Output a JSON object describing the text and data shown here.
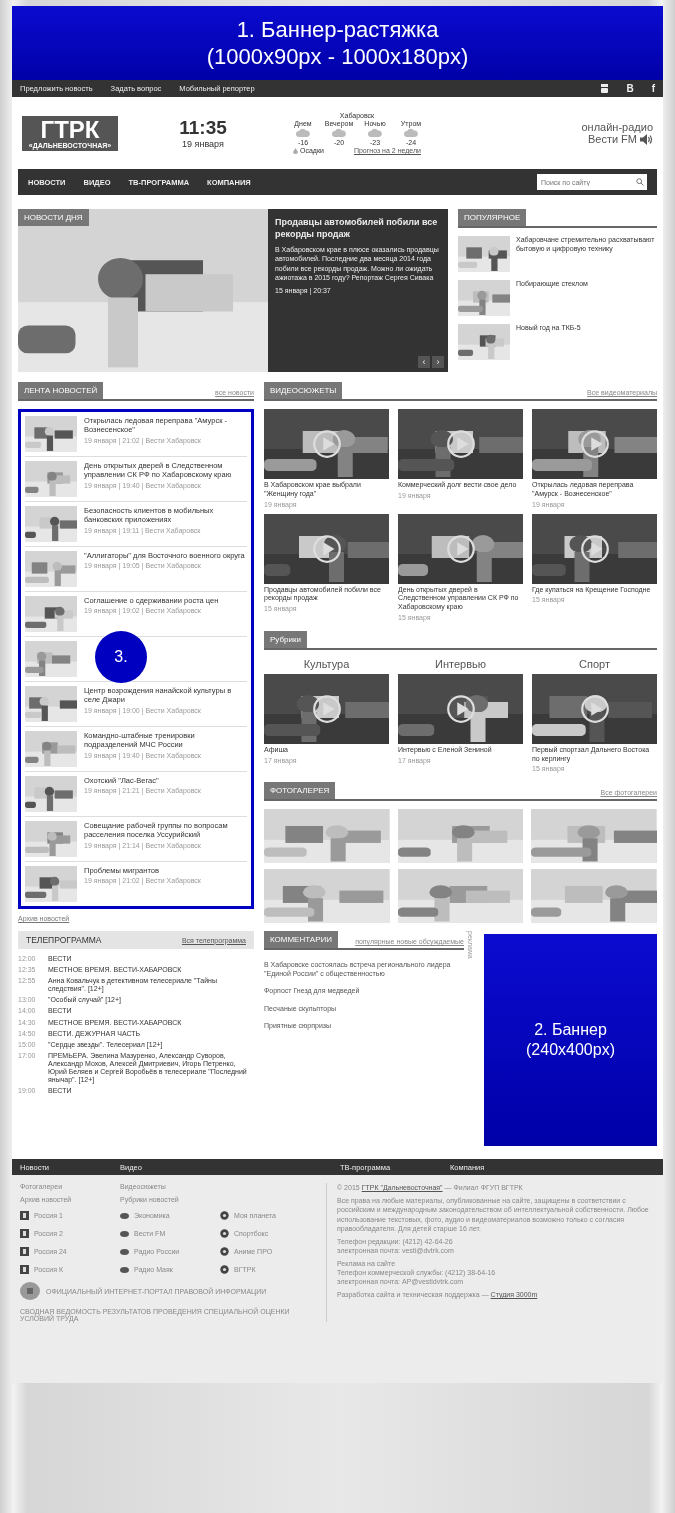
{
  "top_banner": {
    "line_1": "1. Баннер-растяжка",
    "line_2": "(1000x90px - 1000x180px)"
  },
  "top_links": [
    "Предложить новость",
    "Задать вопрос",
    "Мобильный репортер"
  ],
  "social": [
    "B",
    "f"
  ],
  "logo": {
    "title": "ГТРК",
    "subtitle": "«ДАЛЬНЕВОСТОЧНАЯ»"
  },
  "clock": {
    "time": "11:35",
    "date": "19 января"
  },
  "weather": {
    "city": "Хабаровск",
    "periods": [
      {
        "label": "Днем",
        "temp": "-16"
      },
      {
        "label": "Вечером",
        "temp": "-20"
      },
      {
        "label": "Ночью",
        "temp": "-23"
      },
      {
        "label": "Утром",
        "temp": "-24"
      }
    ],
    "note": "Осадки",
    "forecast_link": "Прогноз на 2 недели"
  },
  "radio": {
    "label": "онлайн-радио",
    "name": "Вести FM"
  },
  "nav": {
    "items": [
      "НОВОСТИ",
      "ВИДЕО",
      "ТВ-ПРОГРАММА",
      "КОМПАНИЯ"
    ],
    "search_placeholder": "Поиск по сайту"
  },
  "hero": {
    "label": "НОВОСТИ ДНЯ",
    "title": "Продавцы автомобилей побили все рекорды продаж",
    "text": "В Хабаровском крае в плюсе оказались продавцы автомобилей. Последние два месяца 2014 года побили все рекорды продаж. Можно ли ожидать ажиотажа в 2015 году? Репортаж Сергея Сивака",
    "date": "15 января | 20:37",
    "prev": "‹",
    "next": "›"
  },
  "popular": {
    "heading": "ПОПУЛЯРНОЕ",
    "items": [
      "Хабаровчане стремительно расхватывают бытовую и цифровую технику",
      "Побирающие стеклом",
      "Новый год на ТКБ-5"
    ]
  },
  "news_feed": {
    "heading": "ЛЕНТА НОВОСТЕЙ",
    "all_link": "все новости",
    "items": [
      {
        "title": "Открылась ледовая переправа \"Амурск - Вознесенское\"",
        "meta": "19 января | 21:02 | Вести Хабаровск"
      },
      {
        "title": "День открытых дверей в Следственном управлении СК РФ по Хабаровскому краю",
        "meta": "19 января | 19:40 | Вести Хабаровск"
      },
      {
        "title": "Безопасность клиентов в мобильных банковских приложениях",
        "meta": "19 января | 19:11 | Вести Хабаровск"
      },
      {
        "title": "\"Аллигаторы\" для Восточного военного округа",
        "meta": "19 января | 19:05 | Вести Хабаровск"
      },
      {
        "title": "Соглашение о сдерживании роста цен",
        "meta": "19 января | 19:02 | Вести Хабаровск"
      },
      {
        "kind": "picture"
      },
      {
        "title": "Центр возрождения нанайской культуры в селе Джари",
        "meta": "19 января | 19:00 | Вести Хабаровск"
      },
      {
        "title": "Командно-штабные тренировки подразделений МЧС России",
        "meta": "19 января | 19:40 | Вести Хабаровск"
      },
      {
        "title": "Охотский \"Лас-Вегас\"",
        "meta": "19 января | 21:21 | Вести Хабаровск"
      },
      {
        "title": "Совещание рабочей группы по вопросам расселения поселка Уссурийский",
        "meta": "19 января | 21:14 | Вести Хабаровск"
      },
      {
        "title": "Проблемы мигрантов",
        "meta": "19 января | 21:02 | Вести Хабаровск"
      }
    ],
    "archive_link": "Архив новостей",
    "callout": "3."
  },
  "videos": {
    "heading": "ВИДЕОСЮЖЕТЫ",
    "all_link": "Все видеоматериалы",
    "items": [
      {
        "title": "В Хабаровском крае выбрали \"Женщину года\"",
        "date": "19 января"
      },
      {
        "title": "Коммерческий долг вести свое дело",
        "date": "19 января"
      },
      {
        "title": "Открылась ледовая переправа \"Амурск - Вознесенское\"",
        "date": "19 января"
      },
      {
        "title": "Продавцы автомобилей побили все рекорды продаж",
        "date": "15 января"
      },
      {
        "title": "День открытых дверей в Следственном управлении СК РФ по Хабаровскому краю",
        "date": "15 января"
      },
      {
        "title": "Где купаться на Крещение Господне",
        "date": "15 января"
      }
    ]
  },
  "rubrics": {
    "heading": "Рубрики",
    "items": [
      {
        "category": "Культура",
        "title": "Афиша",
        "date": "17 января"
      },
      {
        "category": "Интервью",
        "title": "Интервью с Еленой Зениной",
        "date": "17 января"
      },
      {
        "category": "Спорт",
        "title": "Первый спортзал Дальнего Востока по керлингу",
        "date": "15 января"
      }
    ]
  },
  "gallery": {
    "heading": "ФОТОГАЛЕРЕЯ",
    "all_link": "Все фотогалереи"
  },
  "tv": {
    "heading": "ТЕЛЕПРОГРАММА",
    "all_link": "Вся телепрограмма",
    "items": [
      {
        "time": "12:00",
        "title": "ВЕСТИ"
      },
      {
        "time": "12:35",
        "title": "МЕСТНОЕ ВРЕМЯ. ВЕСТИ-ХАБАРОВСК"
      },
      {
        "time": "12:55",
        "title": "Анна Ковальчук в детективном телесериале \"Тайны следствия\". [12+]"
      },
      {
        "time": "13:00",
        "title": "\"Особый случай\" [12+]"
      },
      {
        "time": "14:00",
        "title": "ВЕСТИ"
      },
      {
        "time": "14:30",
        "title": "МЕСТНОЕ ВРЕМЯ. ВЕСТИ-ХАБАРОВСК"
      },
      {
        "time": "14:50",
        "title": "ВЕСТИ. ДЕЖУРНАЯ ЧАСТЬ"
      },
      {
        "time": "15:00",
        "title": "\"Сердце звезды\". Телесериал [12+]"
      },
      {
        "time": "17:00",
        "title": "ПРЕМЬЕРА. Эвелина Мазуренко, Александр Суворов, Александр Мохов, Алексей Дмитриевич, Игорь Петренко, Юрий Беляев и Сергей Воробьёв в телесериале \"Последний янычар\". [12+]"
      },
      {
        "time": "19:00",
        "title": "ВЕСТИ"
      }
    ]
  },
  "comments": {
    "heading": "КОММЕНТАРИИ",
    "filters": "популярные  новые  обсуждаемые",
    "side_label": "реклама",
    "items": [
      "В Хабаровске состоялась встреча регионального лидера \"Единой России\" с общественностью",
      "Форпост Гнезд для медведей",
      "Песчаные скульпторы",
      "Приятные сюрпризы"
    ]
  },
  "side_banner": {
    "line_1": "2. Баннер",
    "line_2": "(240x400px)"
  },
  "footer": {
    "nav": [
      "Новости",
      "Видео",
      "ТВ-программа",
      "Компания"
    ],
    "links": [
      "Фотогалереи",
      "Видеосюжеты",
      "Архив новостей",
      "Рубрики новостей"
    ],
    "channels": [
      [
        "Россия 1",
        "Россия 2",
        "Россия 24",
        "Россия К"
      ],
      [
        "Экономика",
        "Вести FM",
        "Радио России",
        "Радио Маяк"
      ],
      [
        "Моя планета",
        "Спортбокс",
        "Аниме ПРО",
        "ВГТРК"
      ]
    ],
    "portal": "ОФИЦИАЛЬНЫЙ ИНТЕРНЕТ-ПОРТАЛ ПРАВОВОЙ ИНФОРМАЦИИ",
    "assessment": "СВОДНАЯ ВЕДОМОСТЬ РЕЗУЛЬТАТОВ ПРОВЕДЕНИЯ СПЕЦИАЛЬНОЙ ОЦЕНКИ УСЛОВИЙ ТРУДА",
    "copyright_year": "© 2015",
    "copyright_link": "ГТРК \"Дальневосточная\"",
    "copyright_rest": "— Филиал ФГУП ВГТРК",
    "rights": "Все права на любые материалы, опубликованные на сайте, защищены в соответствии с российским и международным законодательством об интеллектуальной собственности. Любое использование текстовых, фото, аудио и видеоматериалов возможно только с согласия правообладателя. Для детей старше 16 лет.",
    "contacts": [
      "Телефон редакции: (4212) 42-64-26",
      "электронная почта: vesti@dvtrk.com"
    ],
    "ads": [
      "Реклама на сайте",
      "Телефон коммерческой службы: (4212) 38-64-16",
      "электронная почта: AP@vestidvtrk.com"
    ],
    "dev_text": "Разработка сайта и техническая поддержка —",
    "dev_link": "Студия 3000m"
  }
}
